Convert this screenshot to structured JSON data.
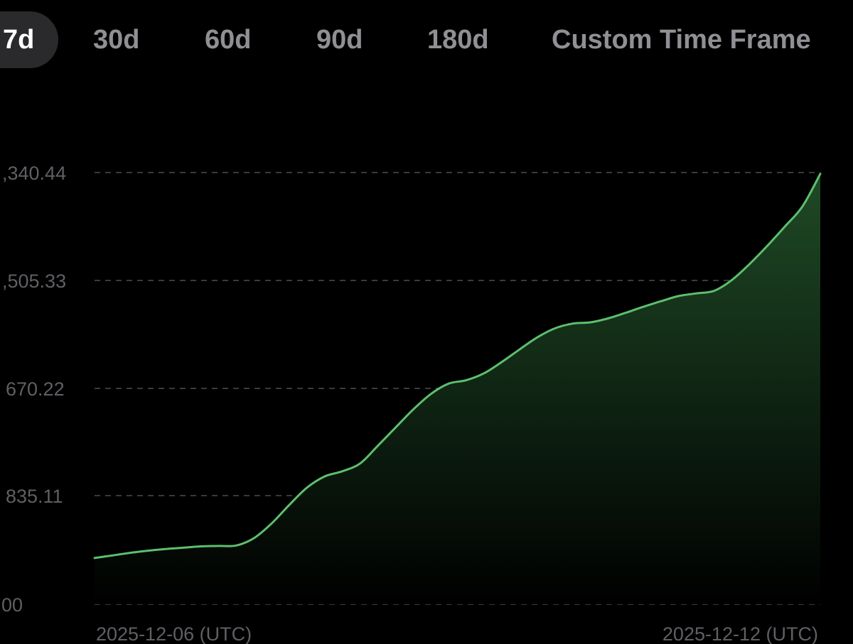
{
  "tabs": [
    {
      "label": "7d",
      "active": true
    },
    {
      "label": "30d",
      "active": false
    },
    {
      "label": "60d",
      "active": false
    },
    {
      "label": "90d",
      "active": false
    },
    {
      "label": "180d",
      "active": false
    },
    {
      "label": "Custom Time Frame",
      "active": false
    }
  ],
  "colors": {
    "background": "#000000",
    "line": "#5dbf6e",
    "fill_top": "#1f4a26",
    "grid": "#3a3a3e",
    "active_tab_bg": "#2a2a2c",
    "inactive_tab_text": "#8f8f94"
  },
  "chart_data": {
    "type": "area",
    "x_tick_labels": [
      "2025-12-06 (UTC)",
      "2025-12-12 (UTC)"
    ],
    "y_tick_labels": [
      ",340.44",
      ",505.33",
      "670.22",
      "835.11",
      "00"
    ],
    "grid": "horizontal-dashed",
    "x": [
      0,
      1,
      2,
      3,
      4,
      5,
      6,
      7,
      8,
      9,
      10,
      11,
      12,
      13,
      14,
      15,
      16,
      17,
      18,
      19,
      20,
      21,
      22,
      23,
      24,
      25,
      26,
      27,
      28,
      29,
      30,
      31,
      32,
      33,
      34,
      35,
      36,
      37,
      38,
      39,
      40,
      41
    ],
    "y_fraction": [
      0.107,
      0.113,
      0.119,
      0.124,
      0.128,
      0.131,
      0.134,
      0.135,
      0.136,
      0.153,
      0.187,
      0.23,
      0.27,
      0.296,
      0.308,
      0.326,
      0.367,
      0.409,
      0.451,
      0.487,
      0.511,
      0.519,
      0.535,
      0.561,
      0.59,
      0.618,
      0.639,
      0.65,
      0.653,
      0.662,
      0.675,
      0.689,
      0.702,
      0.714,
      0.72,
      0.726,
      0.751,
      0.788,
      0.83,
      0.875,
      0.922,
      0.997
    ]
  }
}
